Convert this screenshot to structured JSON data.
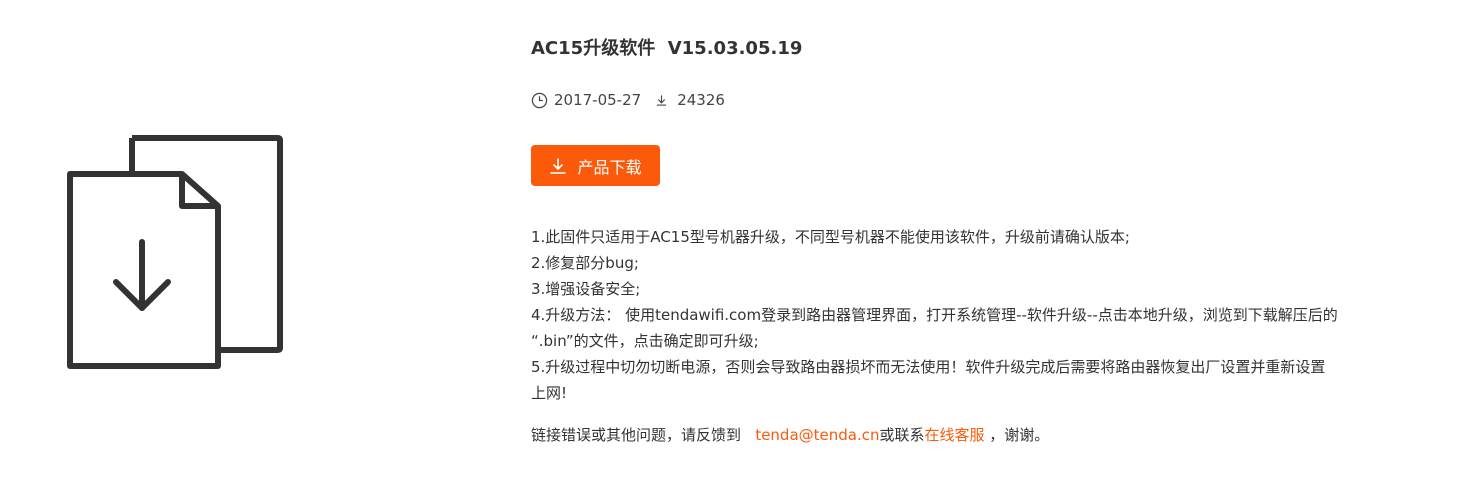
{
  "product": {
    "title": "AC15升级软件  V15.03.05.19",
    "date": "2017-05-27",
    "downloads": "24326",
    "date_icon": "clock-icon",
    "downloads_icon": "download-count-icon",
    "download_button": "产品下载",
    "download_button_icon": "download-icon",
    "illustration_icon": "file-download-icon"
  },
  "notes": {
    "lines": [
      "1.此固件只适用于AC15型号机器升级，不同型号机器不能使用该软件，升级前请确认版本;",
      "2.修复部分bug;",
      "3.增强设备安全;",
      "4.升级方法： 使用tendawifi.com登录到路由器管理界面，打开系统管理--软件升级--点击本地升级，浏览到下载解压后的",
      "“.bin”的文件，点击确定即可升级;",
      "5.升级过程中切勿切断电源，否则会导致路由器损坏而无法使用！软件升级完成后需要将路由器恢复出厂设置并重新设置",
      "上网!"
    ]
  },
  "contact": {
    "prefix": "链接错误或其他问题，请反馈到   ",
    "email": "tenda@tenda.cn",
    "middle": "或联系",
    "service_link": "在线客服",
    "suffix": " ，谢谢。"
  },
  "colors": {
    "accent": "#fa5a0a",
    "text": "#333333",
    "icon_stroke": "#333333"
  }
}
